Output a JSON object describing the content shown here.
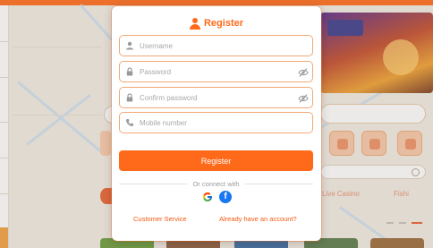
{
  "colors": {
    "accent": "#ff6a1a",
    "title": "#ff6a1a",
    "link": "#f05a12",
    "field_border": "#f3a878",
    "field_icon": "#9a9a9a",
    "button_text": "#ffffff"
  },
  "modal": {
    "title": "Register",
    "title_icon": "user-icon",
    "fields": [
      {
        "name": "username",
        "placeholder": "Username",
        "value": "",
        "icon": "user-icon"
      },
      {
        "name": "password",
        "placeholder": "Password",
        "value": "",
        "icon": "lock-icon",
        "toggle_icon": "eye-off-icon"
      },
      {
        "name": "confirm_password",
        "placeholder": "Confirm password",
        "value": "",
        "icon": "lock-icon",
        "toggle_icon": "eye-off-icon"
      },
      {
        "name": "mobile",
        "placeholder": "Mobile number",
        "value": "",
        "icon": "phone-icon"
      }
    ],
    "register_label": "Register",
    "or_connect": "Or connect with",
    "social": [
      {
        "name": "google",
        "icon": "google-icon"
      },
      {
        "name": "facebook",
        "icon": "facebook-icon",
        "glyph": "f"
      }
    ],
    "customer_service": "Customer Service",
    "have_account": "Already have an account?"
  },
  "background": {
    "live_casino": "Live Casino",
    "fishing": "Fishi"
  }
}
